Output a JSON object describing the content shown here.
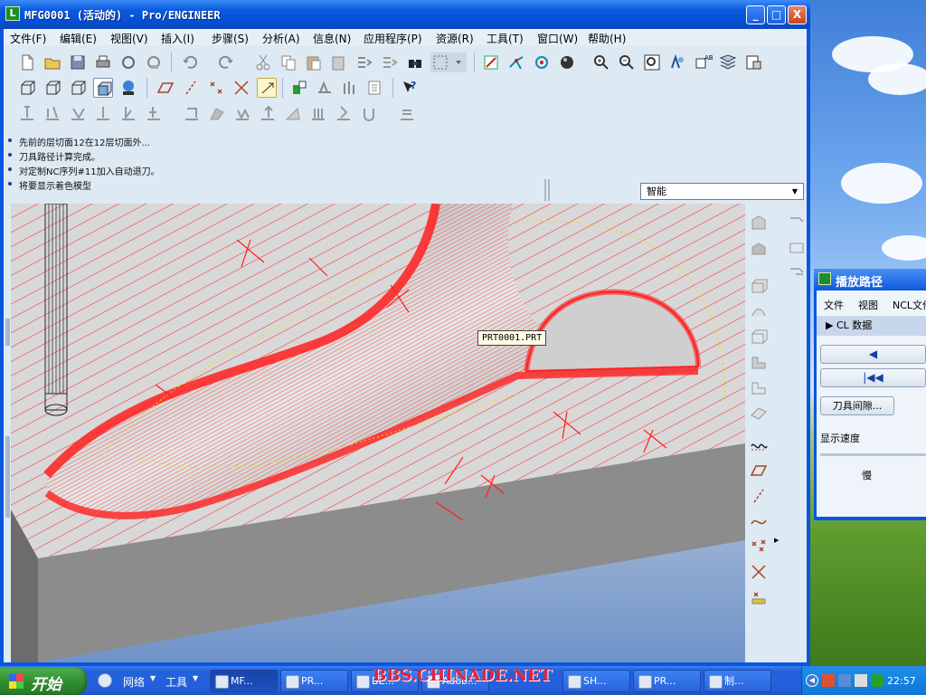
{
  "window": {
    "title": "MFG0001 (活动的) - Pro/ENGINEER",
    "minimize_label": "_",
    "maximize_label": "□",
    "close_label": "X"
  },
  "menu": [
    "文件(F)",
    "编辑(E)",
    "视图(V)",
    "插入(I)",
    "步骤(S)",
    "分析(A)",
    "信息(N)",
    "应用程序(P)",
    "资源(R)",
    "工具(T)",
    "窗口(W)",
    "帮助(H)"
  ],
  "messages": [
    "先前的层切面12在12层切面外...",
    "刀具路径计算完成。",
    "对定制NC序列#11加入自动退刀。",
    "将要显示着色模型"
  ],
  "filter": {
    "selected": "智能"
  },
  "viewport": {
    "tooltip": "PRT0001.PRT",
    "toolpath_color": "#ff2020",
    "stock_color": "#8c8c8c"
  },
  "panel": {
    "title": "播放路径",
    "menu": [
      "文件",
      "视图",
      "NCL文件"
    ],
    "cl_data": "CL 数据",
    "play_back": "◀",
    "rewind": "|◀◀",
    "clearance": "刀具间隙...",
    "speed_label": "显示速度",
    "slow": "慢"
  },
  "taskbar": {
    "start": "开始",
    "network": "网络",
    "tools": "工具",
    "tasks": [
      "MF...",
      "PR...",
      "BE...",
      "Adob...",
      "SH...",
      "PR...",
      "制..."
    ],
    "clock": "22:57"
  },
  "watermark": "BBS.CHINADE.NET"
}
